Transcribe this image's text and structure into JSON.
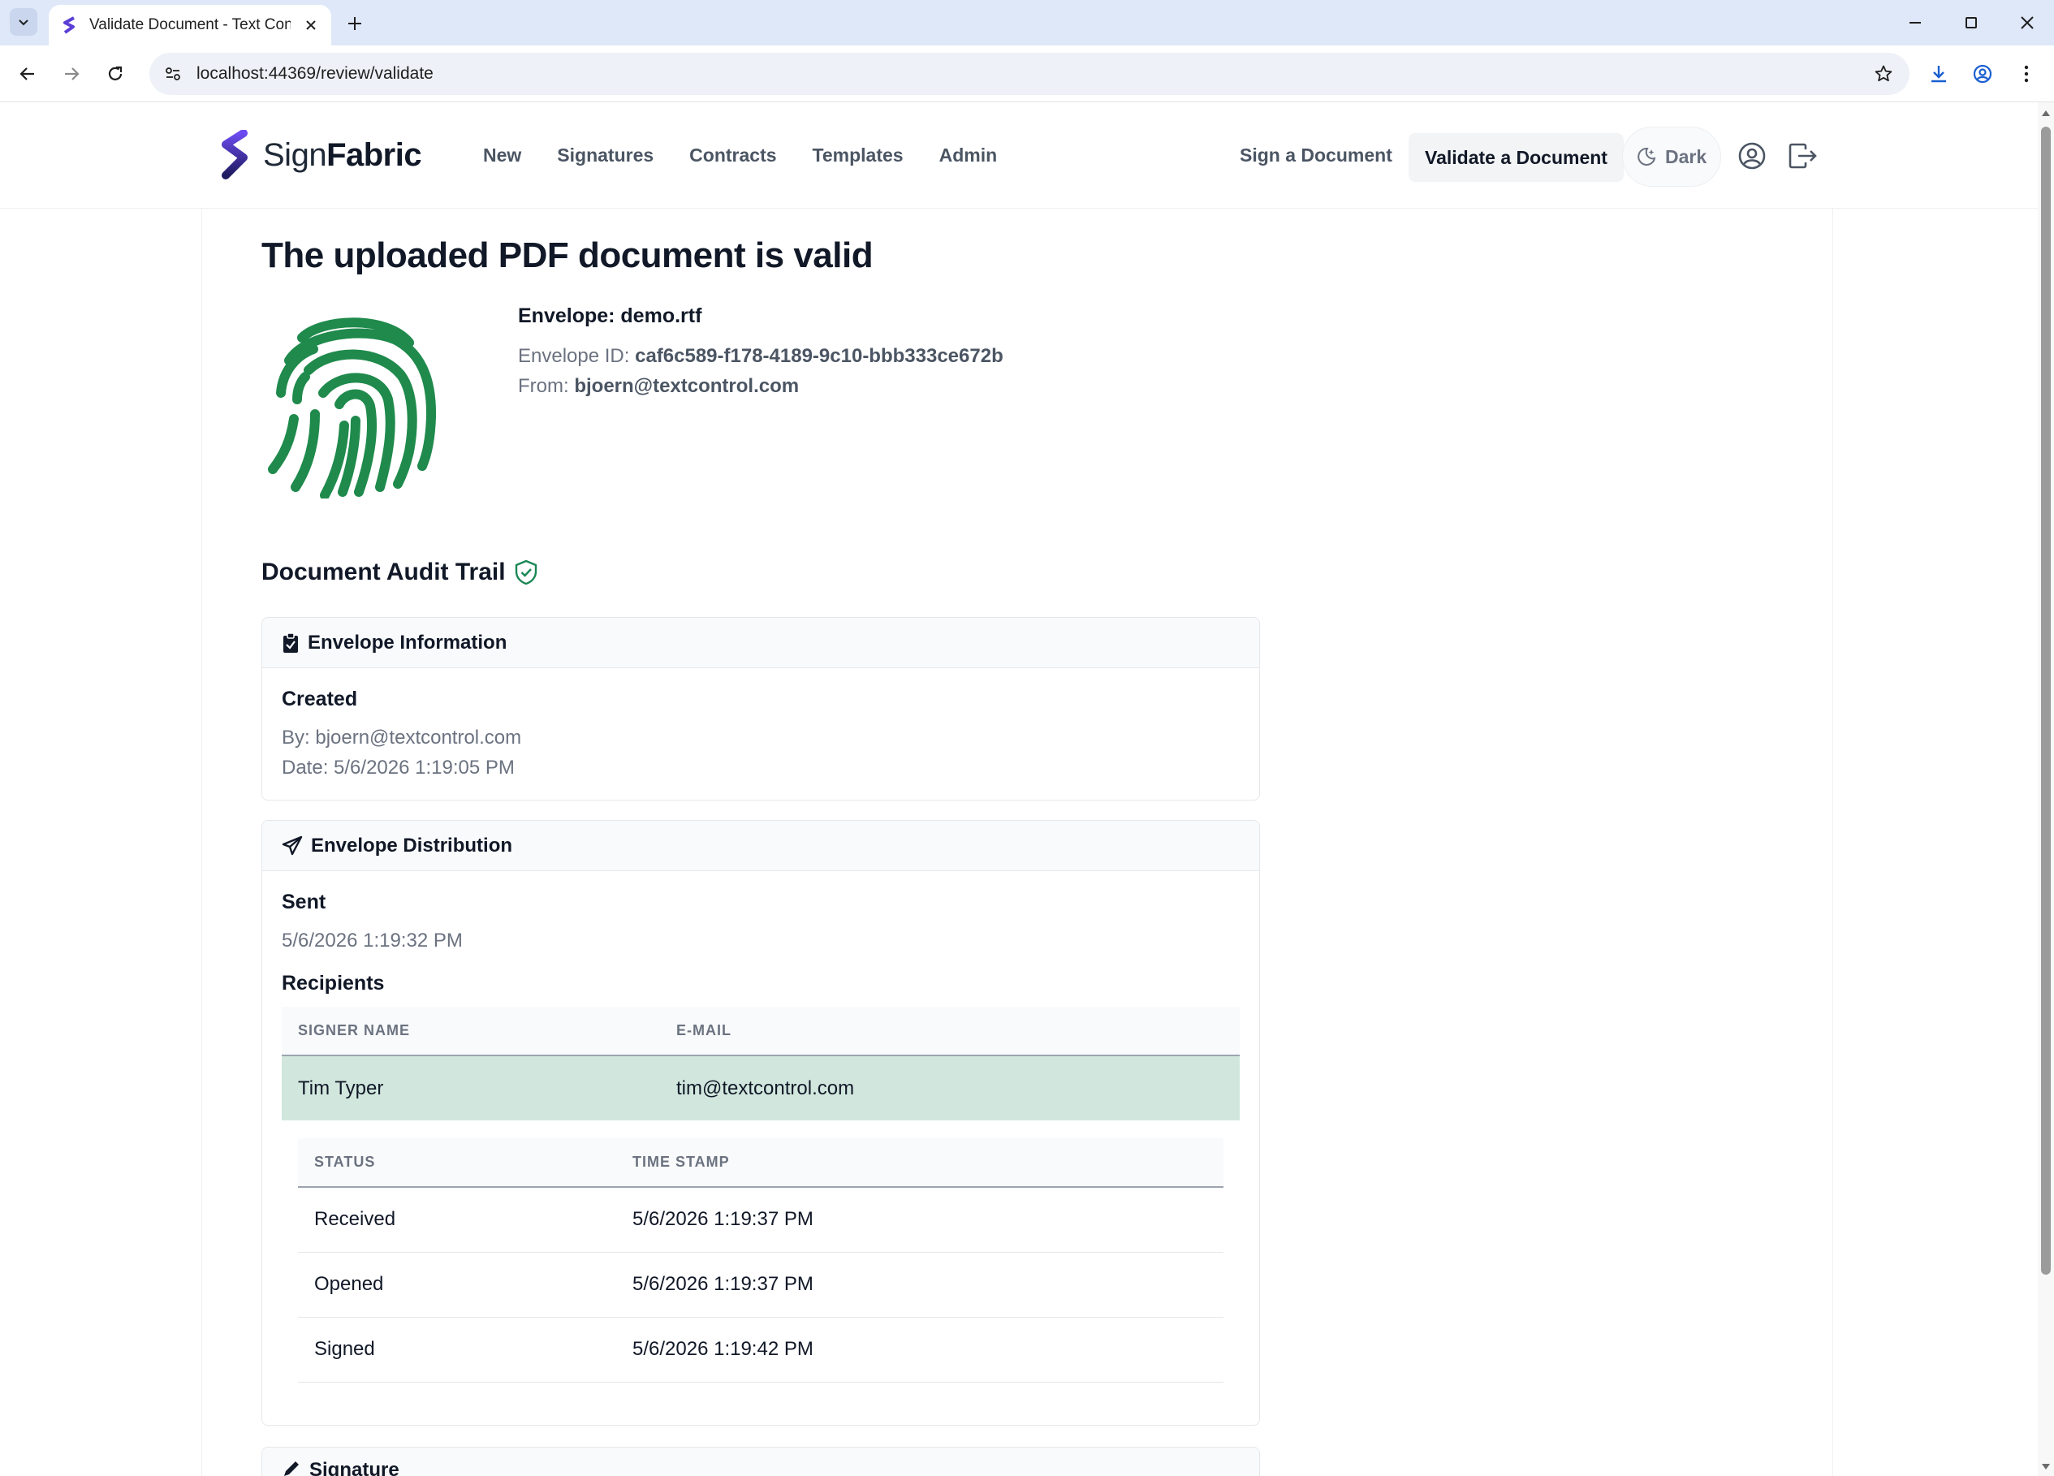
{
  "browser": {
    "tab_title": "Validate Document - Text Control",
    "url": "localhost:44369/review/validate"
  },
  "header": {
    "brand_prefix": "Sign",
    "brand_suffix": "Fabric",
    "nav": [
      "New",
      "Signatures",
      "Contracts",
      "Templates",
      "Admin"
    ],
    "sign_link": "Sign a Document",
    "validate_link": "Validate a Document",
    "theme_toggle": "Dark"
  },
  "page": {
    "title": "The uploaded PDF document is valid",
    "envelope_title": "Envelope: demo.rtf",
    "envelope_id_label": "Envelope ID:",
    "envelope_id": "caf6c589-f178-4189-9c10-bbb333ce672b",
    "from_label": "From:",
    "from": "bjoern@textcontrol.com",
    "audit_title": "Document Audit Trail"
  },
  "envelope_info": {
    "header": "Envelope Information",
    "created_title": "Created",
    "by": "By: bjoern@textcontrol.com",
    "date": "Date: 5/6/2026 1:19:05 PM"
  },
  "distribution": {
    "header": "Envelope Distribution",
    "sent_title": "Sent",
    "sent_date": "5/6/2026 1:19:32 PM",
    "recipients_title": "Recipients",
    "recipient_columns": [
      "Signer Name",
      "E-Mail"
    ],
    "recipients": [
      {
        "name": "Tim Typer",
        "email": "tim@textcontrol.com"
      }
    ],
    "status_columns": [
      "Status",
      "Time Stamp"
    ],
    "statuses": [
      {
        "status": "Received",
        "time": "5/6/2026 1:19:37 PM"
      },
      {
        "status": "Opened",
        "time": "5/6/2026 1:19:37 PM"
      },
      {
        "status": "Signed",
        "time": "5/6/2026 1:19:42 PM"
      }
    ]
  },
  "signature": {
    "header": "Signature"
  },
  "colors": {
    "fingerprint": "#1f8a4c",
    "recipient_row": "#d1e7dd",
    "shield": "#198754"
  }
}
